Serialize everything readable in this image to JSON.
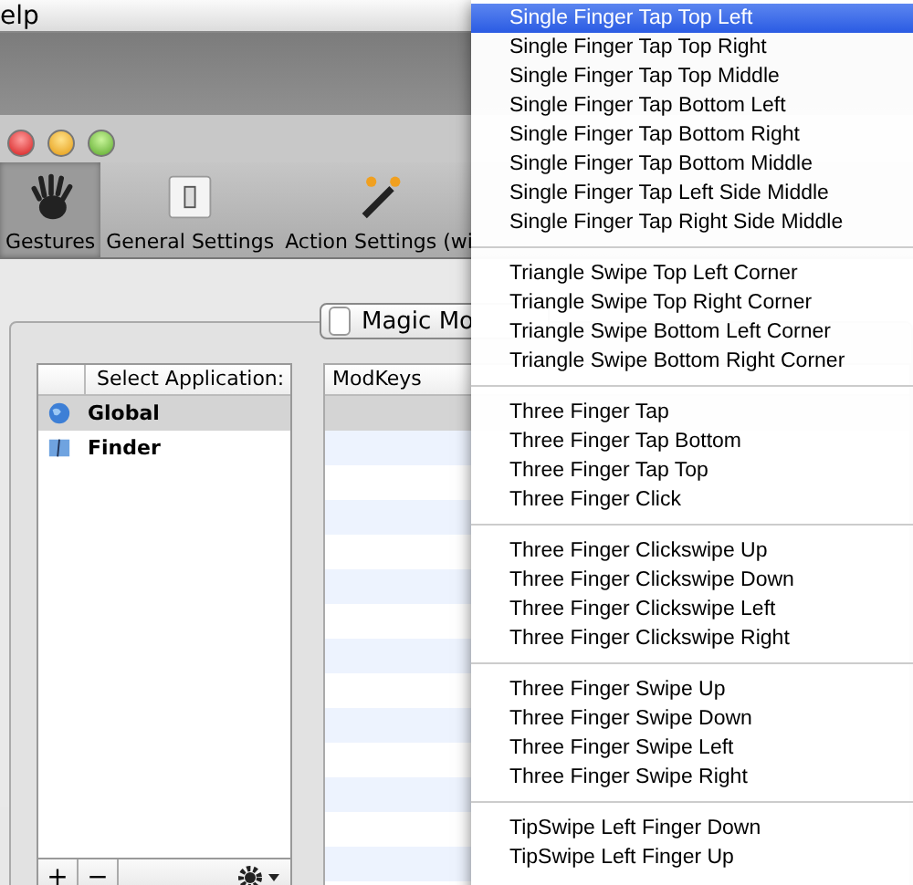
{
  "menubar": {
    "title": "elp"
  },
  "toolbar": [
    {
      "label": "Gestures",
      "selected": true
    },
    {
      "label": "General Settings",
      "selected": false
    },
    {
      "label": "Action Settings (wi",
      "selected": false
    }
  ],
  "segmented": {
    "label": "Magic Mo"
  },
  "apps": {
    "header": "Select Application:",
    "rows": [
      {
        "name": "Global",
        "selected": true
      },
      {
        "name": "Finder",
        "selected": false
      }
    ],
    "buttons": [
      "+",
      "−"
    ]
  },
  "gestures_table": {
    "columns": [
      "ModKeys"
    ]
  },
  "menu": [
    [
      {
        "label": "Single Finger Tap Top Left",
        "selected": true
      },
      {
        "label": "Single Finger Tap Top Right",
        "selected": false
      },
      {
        "label": "Single Finger Tap Top Middle",
        "selected": false
      },
      {
        "label": "Single Finger Tap Bottom Left",
        "selected": false
      },
      {
        "label": "Single Finger Tap Bottom Right",
        "selected": false
      },
      {
        "label": "Single Finger Tap Bottom Middle",
        "selected": false
      },
      {
        "label": "Single Finger Tap Left Side Middle",
        "selected": false
      },
      {
        "label": "Single Finger Tap Right Side Middle",
        "selected": false
      }
    ],
    [
      {
        "label": "Triangle Swipe Top Left Corner",
        "selected": false
      },
      {
        "label": "Triangle Swipe Top Right Corner",
        "selected": false
      },
      {
        "label": "Triangle Swipe Bottom Left Corner",
        "selected": false
      },
      {
        "label": "Triangle Swipe Bottom Right Corner",
        "selected": false
      }
    ],
    [
      {
        "label": "Three Finger Tap",
        "selected": false
      },
      {
        "label": "Three Finger Tap Bottom",
        "selected": false
      },
      {
        "label": "Three Finger Tap Top",
        "selected": false
      },
      {
        "label": "Three Finger Click",
        "selected": false
      }
    ],
    [
      {
        "label": "Three Finger Clickswipe Up",
        "selected": false
      },
      {
        "label": "Three Finger Clickswipe Down",
        "selected": false
      },
      {
        "label": "Three Finger Clickswipe Left",
        "selected": false
      },
      {
        "label": "Three Finger Clickswipe Right",
        "selected": false
      }
    ],
    [
      {
        "label": "Three Finger Swipe Up",
        "selected": false
      },
      {
        "label": "Three Finger Swipe Down",
        "selected": false
      },
      {
        "label": "Three Finger Swipe Left",
        "selected": false
      },
      {
        "label": "Three Finger Swipe Right",
        "selected": false
      }
    ],
    [
      {
        "label": "TipSwipe Left Finger Down",
        "selected": false
      },
      {
        "label": "TipSwipe Left Finger Up",
        "selected": false
      }
    ]
  ]
}
